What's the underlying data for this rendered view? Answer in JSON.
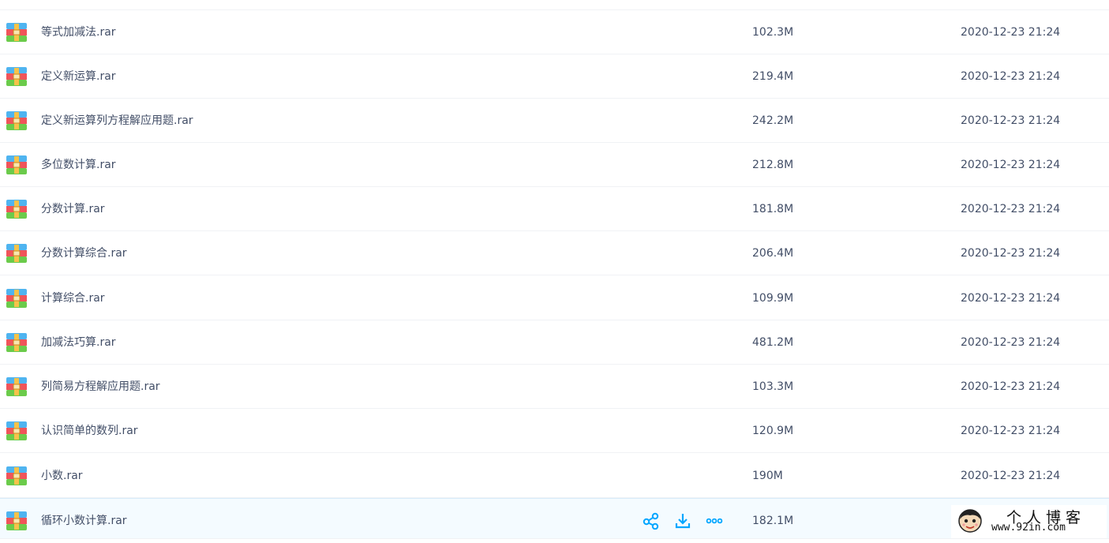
{
  "files": [
    {
      "name": "等式加减法.rar",
      "size": "102.3M",
      "date": "2020-12-23 21:24"
    },
    {
      "name": "定义新运算.rar",
      "size": "219.4M",
      "date": "2020-12-23 21:24"
    },
    {
      "name": "定义新运算列方程解应用题.rar",
      "size": "242.2M",
      "date": "2020-12-23 21:24"
    },
    {
      "name": "多位数计算.rar",
      "size": "212.8M",
      "date": "2020-12-23 21:24"
    },
    {
      "name": "分数计算.rar",
      "size": "181.8M",
      "date": "2020-12-23 21:24"
    },
    {
      "name": "分数计算综合.rar",
      "size": "206.4M",
      "date": "2020-12-23 21:24"
    },
    {
      "name": "计算综合.rar",
      "size": "109.9M",
      "date": "2020-12-23 21:24"
    },
    {
      "name": "加减法巧算.rar",
      "size": "481.2M",
      "date": "2020-12-23 21:24"
    },
    {
      "name": "列简易方程解应用题.rar",
      "size": "103.3M",
      "date": "2020-12-23 21:24"
    },
    {
      "name": "认识简单的数列.rar",
      "size": "120.9M",
      "date": "2020-12-23 21:24"
    },
    {
      "name": "小数.rar",
      "size": "190M",
      "date": "2020-12-23 21:24"
    },
    {
      "name": "循环小数计算.rar",
      "size": "182.1M",
      "date": ""
    }
  ],
  "row_actions_icons": [
    "share-icon",
    "download-icon",
    "more-icon"
  ],
  "file_icon": "rar-archive-icon",
  "watermark": {
    "title": "个人博客",
    "url": "www.92in.com",
    "avatar_icon": "avatar-icon"
  },
  "colors": {
    "text": "#424e67",
    "accent": "#06a7ff",
    "hover_row": "#f4fbff",
    "divider": "#f0f2f5"
  }
}
